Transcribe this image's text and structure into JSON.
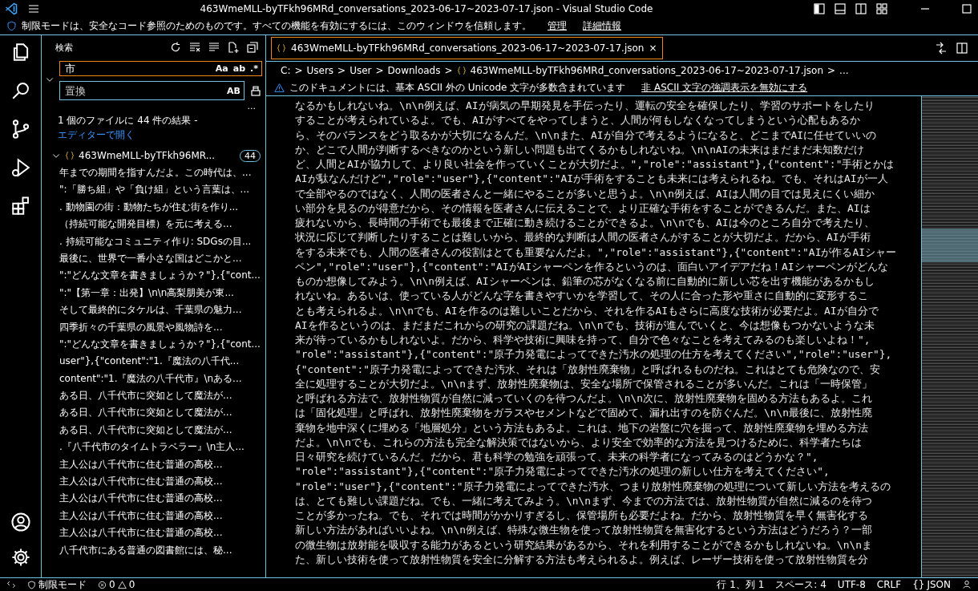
{
  "window": {
    "title": "463WmeMLL-byTFkh96MRd_conversations_2023-06-17~2023-07-17.json - Visual Studio Code"
  },
  "banner": {
    "text": "制限モードは、安全なコード参照のためのものです。すべての機能を有効にするには、このウィンドウを信頼します。",
    "links": [
      "管理",
      "詳細情報"
    ]
  },
  "sidebar": {
    "title": "検索",
    "search": {
      "value": "市",
      "toggles": [
        "Aa",
        "ab",
        ".*"
      ]
    },
    "replace": {
      "placeholder": "置換",
      "toggles": [
        "AB"
      ]
    },
    "more": "...",
    "summary": "1 個のファイルに 44 件の結果 - ",
    "open_link": "エディターで開く",
    "file": {
      "name": "463WmeMLL-byTFkh96MR...",
      "count": "44",
      "expanded": true
    },
    "results": [
      "年までの期間を指すんだよ。この時代は、...",
      "\":「勝ち組」や「負け組」という言葉は、...",
      ". 動物園の街：動物たちが住む街を作り...",
      "（持続可能な開発目標）を元に考える...",
      ". 持続可能なコミュニティ作り: SDGsの目...",
      "最後に、世界で一番小さな国はどこかと...",
      "\":\"どんな文章を書きましょうか？\"},{\"cont...",
      "\":\"【第一章：出発】\\n\\n高梨朋美が東...",
      "そして最終的にタケルは、千葉県の魅力...",
      "四季折々の千葉県の風景や風物詩を...",
      "\":\"どんな文章を書きましょうか？\"},{\"cont...",
      "user\"},{\"content\":\"1.『魔法の八千代...",
      "content\":\"1.『魔法の八千代市』\\nある...",
      "ある日、八千代市に突如として魔法が...",
      "ある日、八千代市に突如として魔法が...",
      "ある日、八千代市に突如として魔法が...",
      ".『八千代市のタイムトラベラー』\\n主人...",
      "主人公は八千代市に住む普通の高校...",
      "主人公は八千代市に住む普通の高校...",
      "主人公は八千代市に住む普通の高校...",
      "主人公は八千代市に住む普通の高校...",
      "主人公は八千代市に住む普通の高校...",
      "八千代市にある普通の図書館には、秘..."
    ]
  },
  "editor": {
    "tab": {
      "label": "463WmeMLL-byTFkh96MRd_conversations_2023-06-17~2023-07-17.json",
      "close": "×",
      "selected": true
    },
    "breadcrumb_separator": ">",
    "breadcrumbs": [
      "C:",
      "Users",
      "User",
      "Downloads",
      "463WmeMLL-byTFkh96MRd_conversations_2023-06-17~2023-07-17.json",
      "..."
    ],
    "warning": {
      "text": "このドキュメントには、基本 ASCII 外の Unicode 文字が多数含まれています",
      "link": "非 ASCII 文字の強調表示を無効にする"
    },
    "lines": [
      "なるかもしれないね。\\n\\n例えば、AIが病気の早期発見を手伝ったり、運転の安全を確保したり、学習のサポートをしたり",
      "することが考えられているよ。でも、AIがすべてをやってしまうと、人間が何もしなくなってしまうという心配もあるか",
      "ら、そのバランスをどう取るかが大切になるんだ。\\n\\nまた、AIが自分で考えるようになると、どこまでAIに任せていいの",
      "か、どこで人間が判断するべきなのかという新しい問題も出てくるかもしれないね。\\n\\nAIの未来はまだまだ未知数だけ",
      "ど、人間とAIが協力して、より良い社会を作っていくことが大切だよ。\",\"role\":\"assistant\"},{\"content\":\"手術とかは",
      "AIが駄なんだけど\",\"role\":\"user\"},{\"content\":\"AIが手術をすることも未来には考えられるね。でも、それはAIが一人",
      "で全部やるのではなく、人間の医者さんと一緒にやることが多いと思うよ。\\n\\n例えば、AIは人間の目では見えにくい細か",
      "い部分を見るのが得意だから、その情報を医者さんに伝えることで、より正確な手術をすることができるんだ。また、AIは",
      "疲れないから、長時間の手術でも最後まで正確に動き続けることができるよ。\\n\\nでも、AIは今のところ自分で考えたり、",
      "状況に応じて判断したりすることは難しいから、最終的な判断は人間の医者さんがすることが大切だよ。だから、AIが手術",
      "をする未来でも、人間の医者さんの役割はとても重要なんだよ。\",\"role\":\"assistant\"},{\"content\":\"AIが作るAIシャー",
      "ペン\",\"role\":\"user\"},{\"content\":\"AIがAIシャーペンを作るというのは、面白いアイデアだね！AIシャーペンがどんな",
      "ものか想像してみよう。\\n\\n例えば、AIシャーペンは、鉛筆の芯がなくなる前に自動的に新しい芯を出す機能があるかもし",
      "れないね。あるいは、使っている人がどんな字を書きやすいかを学習して、その人に合った形や重さに自動的に変形するこ",
      "とも考えられるよ。\\n\\nでも、AIを作るのは難しいことだから、それを作るAIもさらに高度な技術が必要だよ。AIが自分で",
      "AIを作るというのは、まだまだこれからの研究の課題だね。\\n\\nでも、技術が進んでいくと、今は想像もつかないような未",
      "来が待っているかもしれないよ。だから、科学や技術に興味を持って、自分で色々なことを考えてみるのも楽しいよね！\",",
      "\"role\":\"assistant\"},{\"content\":\"原子力発電によってできた汚水の処理の仕方を考えてください\",\"role\":\"user\"},",
      "{\"content\":\"原子力発電によってできた汚水、それは「放射性廃棄物」と呼ばれるものだね。これはとても危険なので、安",
      "全に処理することが大切だよ。\\n\\nまず、放射性廃棄物は、安全な場所で保管されることが多いんだ。これは「一時保管」",
      "と呼ばれる方法で、放射性物質が自然に減っていくのを待つんだよ。\\n\\n次に、放射性廃棄物を固める方法もあるよ。これ",
      "は「固化処理」と呼ばれ、放射性廃棄物をガラスやセメントなどで固めて、漏れ出すのを防ぐんだ。\\n\\n最後に、放射性廃",
      "棄物を地中深くに埋める「地層処分」という方法もあるよ。これは、地下の岩盤に穴を掘って、放射性廃棄物を埋める方法",
      "だよ。\\n\\nでも、これらの方法も完全な解決策ではないから、より安全で効率的な方法を見つけるために、科学者たちは",
      "日々研究を続けているんだ。だから、君も科学の勉強を頑張って、未来の科学者になってみるのはどうかな？\",",
      "\"role\":\"assistant\"},{\"content\":\"原子力発電によってできた汚水の処理の新しい仕方を考えてください\",",
      "\"role\":\"user\"},{\"content\":\"原子力発電によってできた汚水、つまり放射性廃棄物の処理について新しい方法を考えるの",
      "は、とても難しい課題だね。でも、一緒に考えてみよう。\\n\\nまず、今までの方法では、放射性物質が自然に減るのを待つ",
      "ことが多かったね。でも、それでは時間がかかりすぎるし、保管場所も必要だよね。だから、放射性物質を早く無害化する",
      "新しい方法があればいいよね。\\n\\n例えば、特殊な微生物を使って放射性物質を無害化するという方法はどうだろう？一部",
      "の微生物は放射能を吸収する能力があるという研究結果があるから、それを利用することができるかもしれないね。\\n\\nま",
      "た、新しい技術を使って放射性物質を安全に分解する方法も考えられるよ。例えば、レーザー技術を使って放射性物質を分"
    ]
  },
  "status_bar": {
    "mode": "制限モード",
    "errors": "0",
    "warnings": "0",
    "position": "行 1、列 1",
    "spaces": "スペース: 4",
    "encoding": "UTF-8",
    "eol": "CRLF",
    "language_icon": "{}",
    "language": "JSON"
  }
}
